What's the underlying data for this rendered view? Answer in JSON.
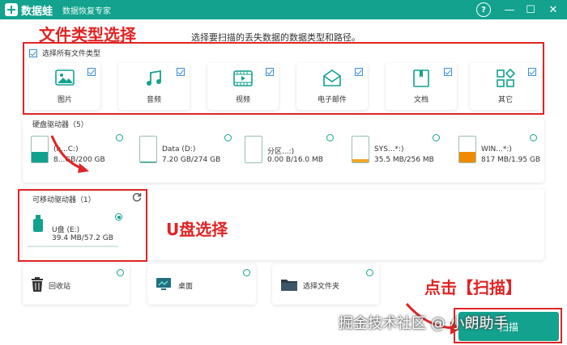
{
  "titlebar": {
    "brand": "数据蛙",
    "subtitle": "数据恢复专家",
    "help_label": "?",
    "minimize_label": "—",
    "maximize_label": "☐",
    "close_label": "✕"
  },
  "annotations": {
    "file_type": "文件类型选择",
    "usb": "U盘选择",
    "scan": "点击【扫描】"
  },
  "instruction": "选择要扫描的丢失数据的数据类型和路径。",
  "select_all_label": "选择所有文件类型",
  "file_types": [
    {
      "label": "图片",
      "icon": "image-icon",
      "checked": true
    },
    {
      "label": "音频",
      "icon": "music-icon",
      "checked": true
    },
    {
      "label": "视频",
      "icon": "video-icon",
      "checked": true
    },
    {
      "label": "电子邮件",
      "icon": "email-icon",
      "checked": true
    },
    {
      "label": "文档",
      "icon": "document-icon",
      "checked": true
    },
    {
      "label": "其它",
      "icon": "other-icon",
      "checked": true
    }
  ],
  "hard_drives": {
    "title": "硬盘驱动器（5）",
    "items": [
      {
        "name": "(n...C:)",
        "size": "8...GB/200 GB",
        "fill": 0.42,
        "color": "#12a28e"
      },
      {
        "name": "Data (D:)",
        "size": "7.20 GB/274 GB",
        "fill": 0.03,
        "color": "#12a28e"
      },
      {
        "name": "分区...:)",
        "size": "0.00  B/16.0 MB",
        "fill": 0.0,
        "color": "#12a28e"
      },
      {
        "name": "SYS...*:)",
        "size": "35.5 MB/256 MB",
        "fill": 0.14,
        "color": "#f5a623"
      },
      {
        "name": "WIN...*:)",
        "size": "817 MB/1.95 GB",
        "fill": 0.42,
        "color": "#f08a00"
      }
    ]
  },
  "removable": {
    "title": "可移动驱动器（1）",
    "refresh_icon": "refresh-icon",
    "item": {
      "name": "U盘 (E:)",
      "size": "39.4 MB/57.2 GB",
      "fill": 0.001,
      "selected": true
    }
  },
  "locations": [
    {
      "label": "回收站",
      "icon": "recycle-bin-icon"
    },
    {
      "label": "桌面",
      "icon": "desktop-icon"
    },
    {
      "label": "选择文件夹",
      "icon": "folder-icon"
    }
  ],
  "scan_button": "扫描",
  "watermark": "掘金技术社区 @ 小朗助手"
}
